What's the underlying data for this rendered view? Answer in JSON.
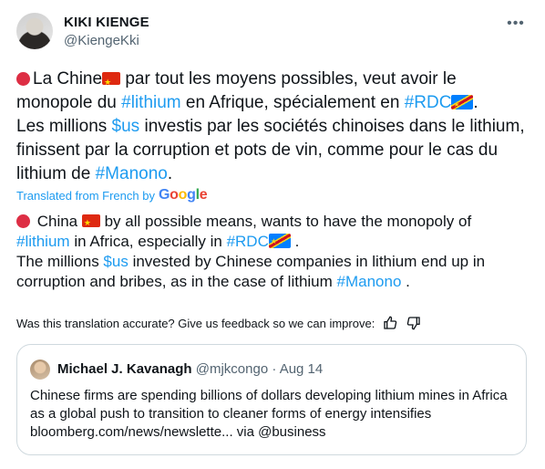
{
  "author": {
    "name": "KIKI KIENGE",
    "handle": "@KiengeKki"
  },
  "original": {
    "p1_a": "La Chine",
    "p1_b": " par tout les moyens possibles, veut avoir le monopole du ",
    "tag_lithium": "#lithium",
    "p1_c": " en Afrique, spécialement en ",
    "tag_rdc": "#RDC",
    "p1_d": ".",
    "p2_a": "Les millions ",
    "tag_us": "$us",
    "p2_b": " investis par les sociétés chinoises dans le lithium, finissent par la corruption et pots de vin, comme pour le cas du lithium de ",
    "tag_manono": "#Manono",
    "p2_c": "."
  },
  "translation_note": {
    "label": "Translated from French by",
    "google": [
      "G",
      "o",
      "o",
      "g",
      "l",
      "e"
    ]
  },
  "translation": {
    "p1_a": " China ",
    "p1_b": " by all possible means, wants to have the monopoly of ",
    "tag_lithium": "#lithium",
    "p1_c": " in Africa, especially in ",
    "tag_rdc": "#RDC",
    "p1_d": " .",
    "p2_a": "The millions ",
    "tag_us": "$us",
    "p2_b": " invested by Chinese companies in lithium end up in corruption and bribes, as in the case of lithium ",
    "tag_manono": "#Manono",
    "p2_c": " ."
  },
  "feedback": {
    "question": "Was this translation accurate? Give us feedback so we can improve:"
  },
  "quote": {
    "name": "Michael J. Kavanagh",
    "handle": "@mjkcongo",
    "separator": " · ",
    "date": "Aug 14",
    "text": "Chinese firms are spending billions of dollars developing lithium mines in Africa as a global push to transition to cleaner forms of energy intensifies bloomberg.com/news/newslette... via @business"
  },
  "colors": {
    "link": "#1d9bf0",
    "muted": "#536471",
    "text": "#0f1419"
  },
  "icons": [
    "more-icon",
    "thumbs-up-icon",
    "thumbs-down-icon",
    "red-circle-icon",
    "china-flag-icon",
    "drc-flag-icon"
  ]
}
